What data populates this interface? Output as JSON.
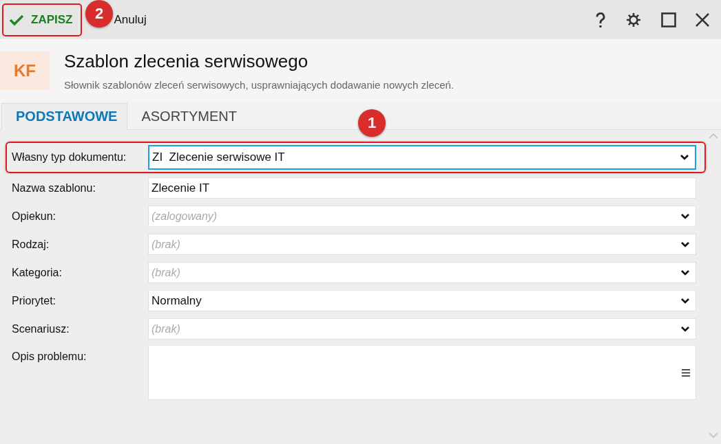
{
  "toolbar": {
    "save_button": {
      "label": "ZAPISZ",
      "highlighted": true,
      "badge": "2"
    },
    "cancel_button": {
      "label": "Anuluj"
    }
  },
  "header": {
    "logo": "KF",
    "title": "Szablon zlecenia serwisowego",
    "subtitle": "Słownik szablonów zleceń serwisowych, usprawniających dodawanie nowych zleceń."
  },
  "tabs": [
    {
      "label": "PODSTAWOWE",
      "selected": true
    },
    {
      "label": "ASORTYMENT",
      "selected": false
    }
  ],
  "fields": [
    {
      "kind": "select",
      "label": "Własny typ dokumentu:",
      "value": "ZI  Zlecenie serwisowe IT",
      "focused": true,
      "highlighted": true,
      "badge": "1"
    },
    {
      "kind": "text",
      "label": "Nazwa szablonu:",
      "value": "Zlecenie IT",
      "focused": false,
      "highlighted": false
    },
    {
      "kind": "select",
      "label": "Opiekun:",
      "placeholder": "(zalogowany)",
      "focused": false,
      "highlighted": false
    },
    {
      "kind": "select",
      "label": "Rodzaj:",
      "placeholder": "(brak)",
      "focused": false,
      "highlighted": false
    },
    {
      "kind": "select",
      "label": "Kategoria:",
      "placeholder": "(brak)",
      "focused": false,
      "highlighted": false
    },
    {
      "kind": "select",
      "label": "Priorytet:",
      "value": "Normalny",
      "focused": false,
      "highlighted": false
    },
    {
      "kind": "select",
      "label": "Scenariusz:",
      "placeholder": "(brak)",
      "focused": false,
      "highlighted": false
    },
    {
      "kind": "textarea",
      "label": "Opis problemu:",
      "focused": false,
      "highlighted": false
    }
  ]
}
